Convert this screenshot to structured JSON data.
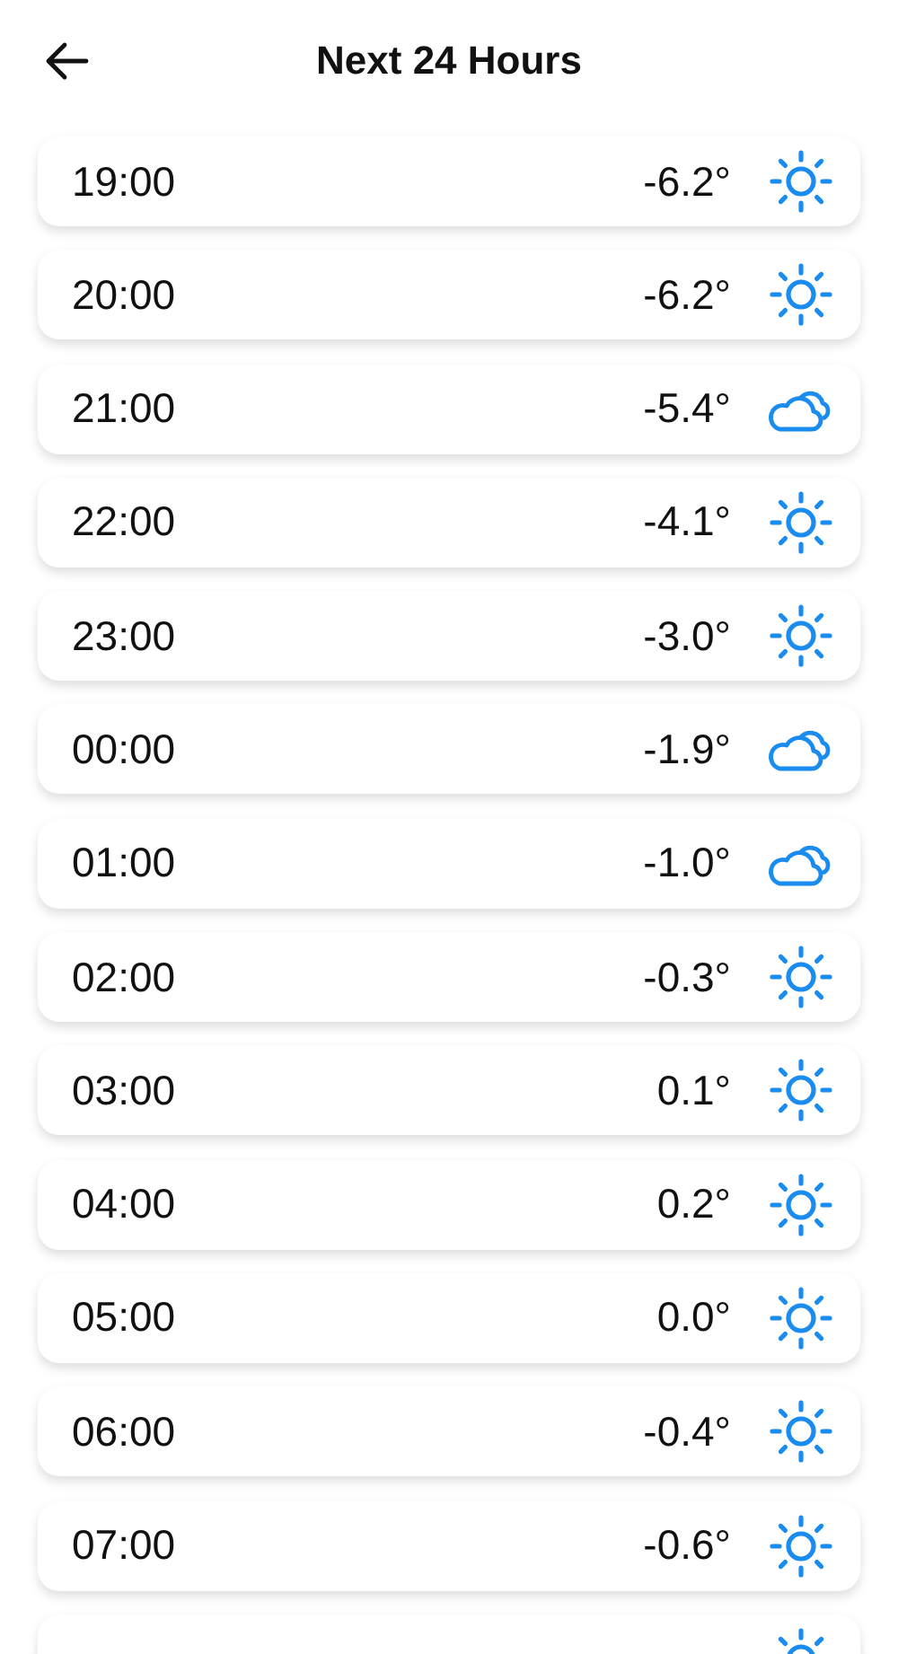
{
  "header": {
    "title": "Next 24 Hours"
  },
  "hours": [
    {
      "time": "19:00",
      "temperature": "-6.2°",
      "kind": "sunny"
    },
    {
      "time": "20:00",
      "temperature": "-6.2°",
      "kind": "sunny"
    },
    {
      "time": "21:00",
      "temperature": "-5.4°",
      "kind": "cloudy"
    },
    {
      "time": "22:00",
      "temperature": "-4.1°",
      "kind": "sunny"
    },
    {
      "time": "23:00",
      "temperature": "-3.0°",
      "kind": "sunny"
    },
    {
      "time": "00:00",
      "temperature": "-1.9°",
      "kind": "cloudy"
    },
    {
      "time": "01:00",
      "temperature": "-1.0°",
      "kind": "cloudy"
    },
    {
      "time": "02:00",
      "temperature": "-0.3°",
      "kind": "sunny"
    },
    {
      "time": "03:00",
      "temperature": "0.1°",
      "kind": "sunny"
    },
    {
      "time": "04:00",
      "temperature": "0.2°",
      "kind": "sunny"
    },
    {
      "time": "05:00",
      "temperature": "0.0°",
      "kind": "sunny"
    },
    {
      "time": "06:00",
      "temperature": "-0.4°",
      "kind": "sunny"
    },
    {
      "time": "07:00",
      "temperature": "-0.6°",
      "kind": "sunny"
    },
    {
      "kind": "sunny"
    }
  ]
}
